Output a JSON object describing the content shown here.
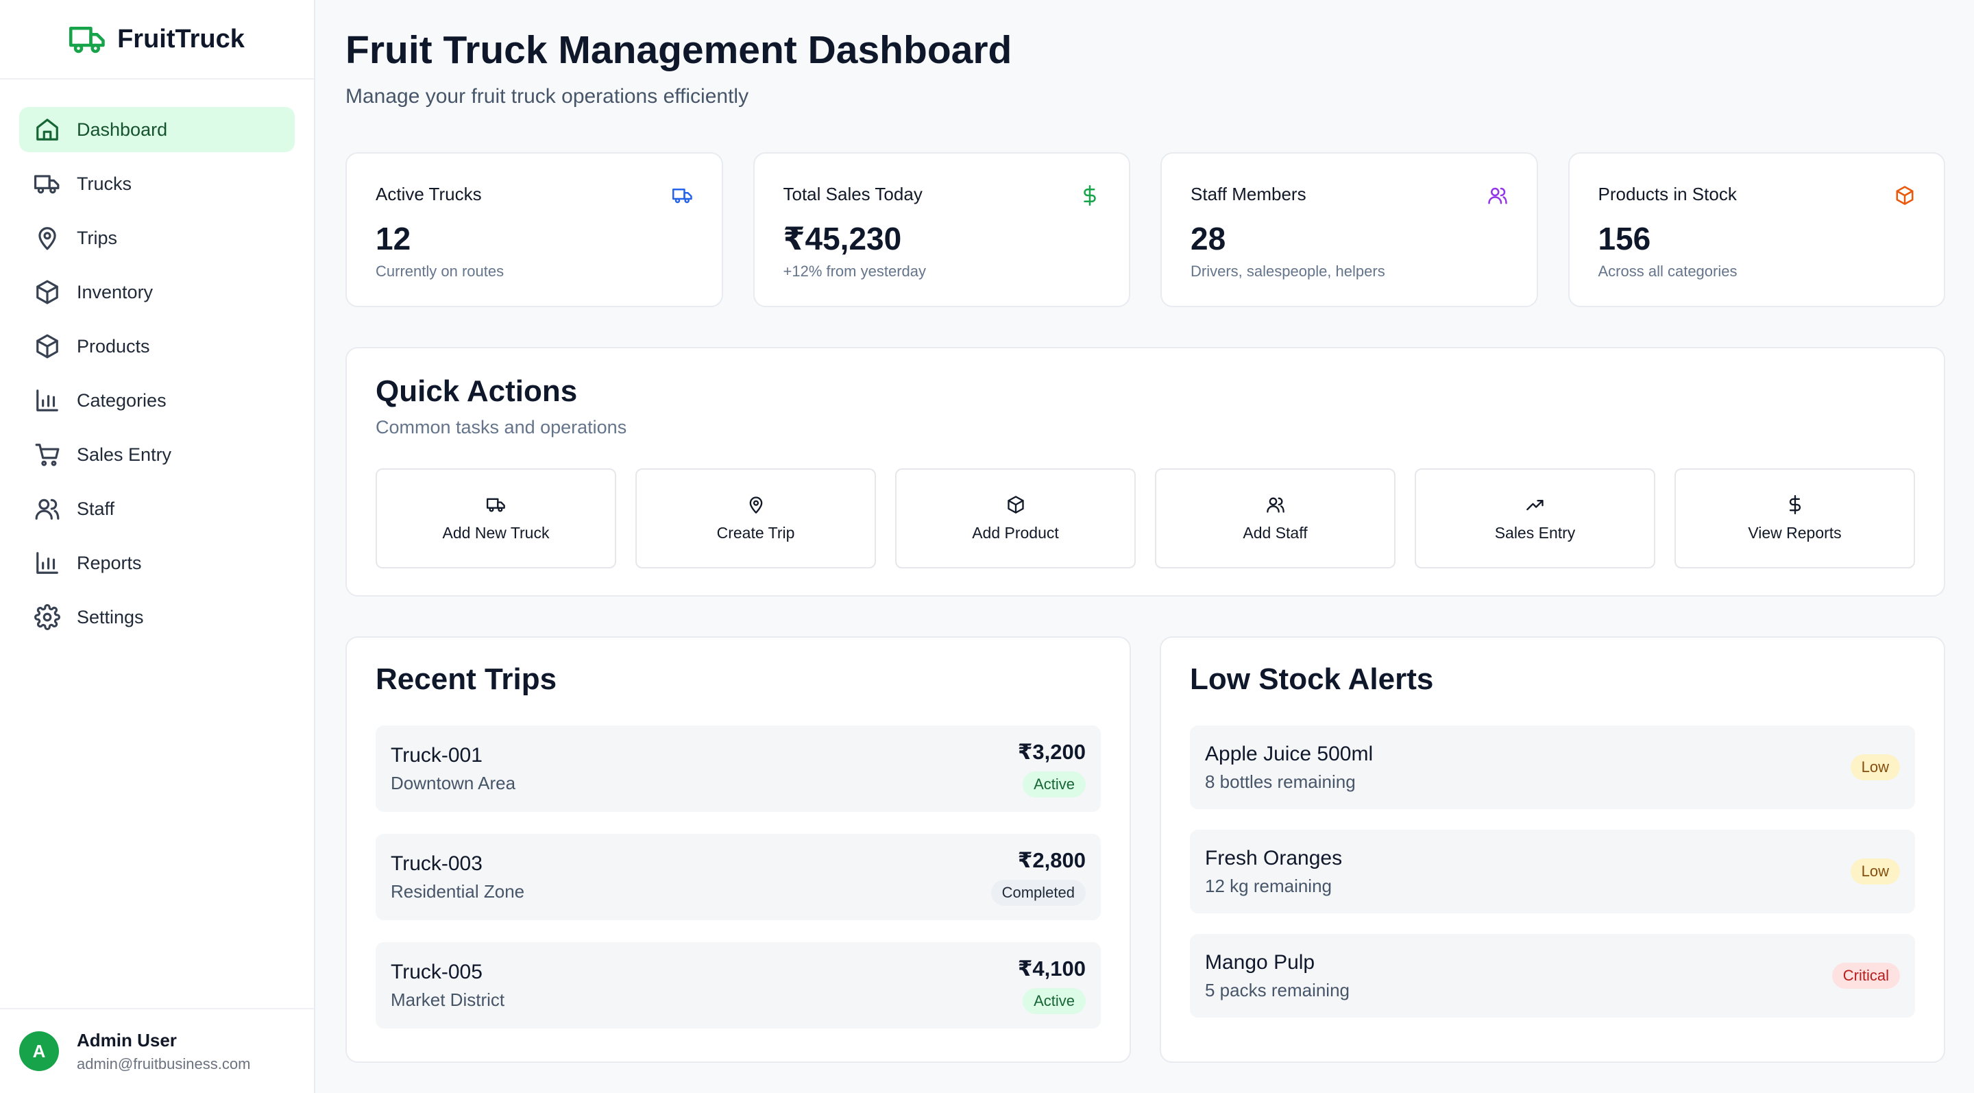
{
  "brand": {
    "name": "FruitTruck",
    "icon": "truck-icon"
  },
  "sidebar": {
    "items": [
      {
        "label": "Dashboard",
        "icon": "home-icon",
        "active": true
      },
      {
        "label": "Trucks",
        "icon": "truck-icon"
      },
      {
        "label": "Trips",
        "icon": "map-pin-icon"
      },
      {
        "label": "Inventory",
        "icon": "package-icon"
      },
      {
        "label": "Products",
        "icon": "package-icon"
      },
      {
        "label": "Categories",
        "icon": "bar-chart-icon"
      },
      {
        "label": "Sales Entry",
        "icon": "cart-icon"
      },
      {
        "label": "Staff",
        "icon": "users-icon"
      },
      {
        "label": "Reports",
        "icon": "bar-chart-icon"
      },
      {
        "label": "Settings",
        "icon": "gear-icon"
      }
    ]
  },
  "user": {
    "initial": "A",
    "name": "Admin User",
    "email": "admin@fruitbusiness.com"
  },
  "header": {
    "title": "Fruit Truck Management Dashboard",
    "subtitle": "Manage your fruit truck operations efficiently"
  },
  "stats": [
    {
      "label": "Active Trucks",
      "value": "12",
      "note": "Currently on routes",
      "icon": "truck-icon",
      "color": "#2563eb"
    },
    {
      "label": "Total Sales Today",
      "value": "₹45,230",
      "note": "+12% from yesterday",
      "icon": "dollar-icon",
      "color": "#16a34a"
    },
    {
      "label": "Staff Members",
      "value": "28",
      "note": "Drivers, salespeople, helpers",
      "icon": "users-icon",
      "color": "#9333ea"
    },
    {
      "label": "Products in Stock",
      "value": "156",
      "note": "Across all categories",
      "icon": "package-icon",
      "color": "#ea580c"
    }
  ],
  "quick_actions": {
    "title": "Quick Actions",
    "subtitle": "Common tasks and operations",
    "items": [
      {
        "label": "Add New Truck",
        "icon": "truck-icon"
      },
      {
        "label": "Create Trip",
        "icon": "map-pin-icon"
      },
      {
        "label": "Add Product",
        "icon": "package-icon"
      },
      {
        "label": "Add Staff",
        "icon": "users-icon"
      },
      {
        "label": "Sales Entry",
        "icon": "trending-up-icon"
      },
      {
        "label": "View Reports",
        "icon": "dollar-icon"
      }
    ]
  },
  "recent_trips": {
    "title": "Recent Trips",
    "items": [
      {
        "truck": "Truck-001",
        "area": "Downtown Area",
        "amount": "₹3,200",
        "status": "Active"
      },
      {
        "truck": "Truck-003",
        "area": "Residential Zone",
        "amount": "₹2,800",
        "status": "Completed"
      },
      {
        "truck": "Truck-005",
        "area": "Market District",
        "amount": "₹4,100",
        "status": "Active"
      }
    ]
  },
  "low_stock": {
    "title": "Low Stock Alerts",
    "items": [
      {
        "name": "Apple Juice 500ml",
        "remaining": "8 bottles remaining",
        "level": "Low"
      },
      {
        "name": "Fresh Oranges",
        "remaining": "12 kg remaining",
        "level": "Low"
      },
      {
        "name": "Mango Pulp",
        "remaining": "5 packs remaining",
        "level": "Critical"
      }
    ]
  }
}
